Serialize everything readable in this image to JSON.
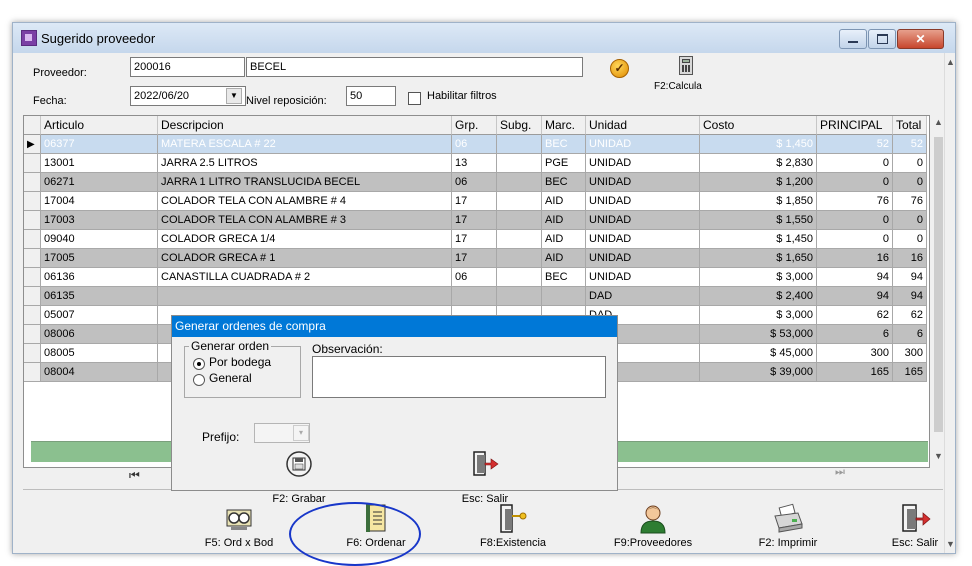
{
  "window": {
    "title": "Sugerido proveedor"
  },
  "form": {
    "proveedor_label": "Proveedor:",
    "proveedor_code": "200016",
    "proveedor_name": "BECEL",
    "fecha_label": "Fecha:",
    "fecha_value": "2022/06/20",
    "nivel_label": "Nivel reposición:",
    "nivel_value": "50",
    "filtros_label": "Habilitar filtros",
    "calcula_label": "F2:Calcula"
  },
  "grid": {
    "columns": [
      "Articulo",
      "Descripcion",
      "Grp.",
      "Subg.",
      "Marc.",
      "Unidad",
      "Costo",
      "PRINCIPAL",
      "Total"
    ],
    "rows": [
      [
        "06377",
        "MATERA ESCALA # 22",
        "06",
        "",
        "BEC",
        "UNIDAD",
        "$ 1,450",
        "52",
        "52"
      ],
      [
        "13001",
        "JARRA 2.5 LITROS",
        "13",
        "",
        "PGE",
        "UNIDAD",
        "$ 2,830",
        "0",
        "0"
      ],
      [
        "06271",
        "JARRA 1 LITRO TRANSLUCIDA BECEL",
        "06",
        "",
        "BEC",
        "UNIDAD",
        "$ 1,200",
        "0",
        "0"
      ],
      [
        "17004",
        "COLADOR TELA CON ALAMBRE # 4",
        "17",
        "",
        "AID",
        "UNIDAD",
        "$ 1,850",
        "76",
        "76"
      ],
      [
        "17003",
        "COLADOR TELA CON ALAMBRE # 3",
        "17",
        "",
        "AID",
        "UNIDAD",
        "$ 1,550",
        "0",
        "0"
      ],
      [
        "09040",
        "COLADOR GRECA 1/4",
        "17",
        "",
        "AID",
        "UNIDAD",
        "$ 1,450",
        "0",
        "0"
      ],
      [
        "17005",
        "COLADOR GRECA # 1",
        "17",
        "",
        "AID",
        "UNIDAD",
        "$ 1,650",
        "16",
        "16"
      ],
      [
        "06136",
        "CANASTILLA CUADRADA # 2",
        "06",
        "",
        "BEC",
        "UNIDAD",
        "$ 3,000",
        "94",
        "94"
      ],
      [
        "06135",
        "",
        "",
        "",
        "",
        "DAD",
        "$ 2,400",
        "94",
        "94"
      ],
      [
        "05007",
        "",
        "",
        "",
        "",
        "DAD",
        "$ 3,000",
        "62",
        "62"
      ],
      [
        "08006",
        "",
        "",
        "",
        "",
        "DAD",
        "$ 53,000",
        "6",
        "6"
      ],
      [
        "08005",
        "",
        "",
        "",
        "",
        "DAD",
        "$ 45,000",
        "300",
        "300"
      ],
      [
        "08004",
        "",
        "",
        "",
        "",
        "IA",
        "$ 39,000",
        "165",
        "165"
      ]
    ]
  },
  "dialog": {
    "title": "Generar ordenes de compra",
    "group_title": "Generar orden",
    "option_bodega": "Por bodega",
    "option_general": "General",
    "obs_label": "Observación:",
    "prefijo_label": "Prefijo:",
    "grabar_label": "F2: Grabar",
    "salir_label": "Esc: Salir"
  },
  "toolbar": {
    "ord_bod": "F5: Ord x Bod",
    "ordenar": "F6: Ordenar",
    "existencia": "F8:Existencia",
    "proveedores": "F9:Proveedores",
    "imprimir": "F2: Imprimir",
    "salir": "Esc: Salir"
  }
}
